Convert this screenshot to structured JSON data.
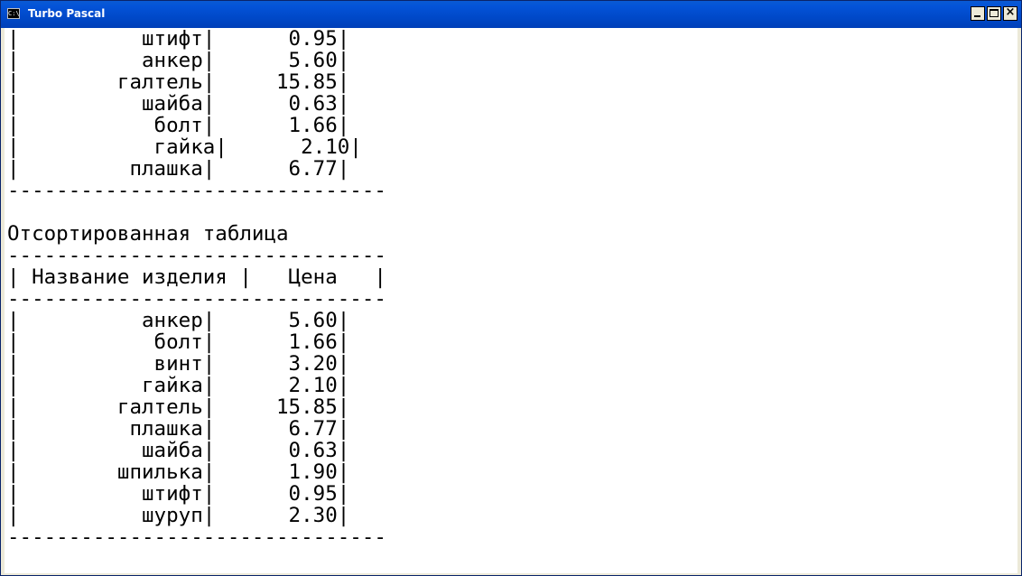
{
  "window": {
    "title": "Turbo Pascal",
    "icon_text": "C:\\",
    "close_glyph": "×"
  },
  "console": {
    "lines": [
      "|          штифт|      0.95|",
      "|          анкер|      5.60|",
      "|        галтель|     15.85|",
      "|          шайба|      0.63|",
      "|           болт|      1.66|",
      "|           гайка|      2.10|",
      "|         плашка|      6.77|",
      "-------------------------------",
      "",
      "Отсортированная таблица",
      "-------------------------------",
      "| Название изделия |   Цена   |",
      "-------------------------------",
      "|          анкер|      5.60|",
      "|           болт|      1.66|",
      "|           винт|      3.20|",
      "|          гайка|      2.10|",
      "|        галтель|     15.85|",
      "|         плашка|      6.77|",
      "|          шайба|      0.63|",
      "|        шпилька|      1.90|",
      "|          штифт|      0.95|",
      "|          шуруп|      2.30|",
      "-------------------------------"
    ]
  }
}
